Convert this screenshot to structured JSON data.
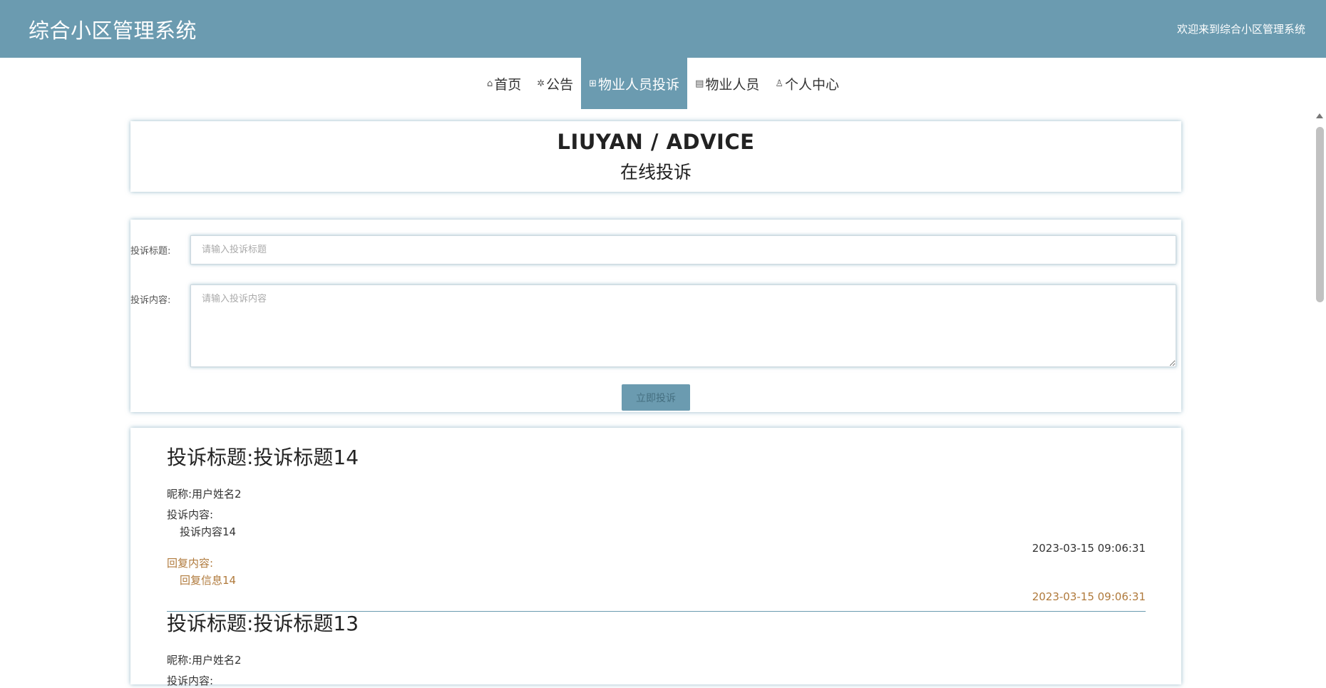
{
  "header": {
    "title": "综合小区管理系统",
    "welcome": "欢迎来到综合小区管理系统"
  },
  "nav": {
    "items": [
      {
        "label": "首页",
        "icon": "home-icon"
      },
      {
        "label": "公告",
        "icon": "announcement-icon"
      },
      {
        "label": "物业人员投诉",
        "icon": "complaint-icon",
        "active": true
      },
      {
        "label": "物业人员",
        "icon": "staff-icon"
      },
      {
        "label": "个人中心",
        "icon": "user-icon"
      }
    ]
  },
  "hero": {
    "title_en": "LIUYAN / ADVICE",
    "title_cn": "在线投诉"
  },
  "form": {
    "title_label": "投诉标题:",
    "title_placeholder": "请输入投诉标题",
    "content_label": "投诉内容:",
    "content_placeholder": "请输入投诉内容",
    "submit_label": "立即投诉"
  },
  "complaints": [
    {
      "title": "投诉标题:投诉标题14",
      "nickname": "昵称:用户姓名2",
      "content_label": "投诉内容:",
      "content": "投诉内容14",
      "content_time": "2023-03-15 09:06:31",
      "reply_label": "回复内容:",
      "reply": "回复信息14",
      "reply_time": "2023-03-15 09:06:31"
    },
    {
      "title": "投诉标题:投诉标题13",
      "nickname": "昵称:用户姓名2",
      "content_label": "投诉内容:"
    }
  ],
  "colors": {
    "accent": "#6b9bb0",
    "reply": "#b07a3c"
  }
}
